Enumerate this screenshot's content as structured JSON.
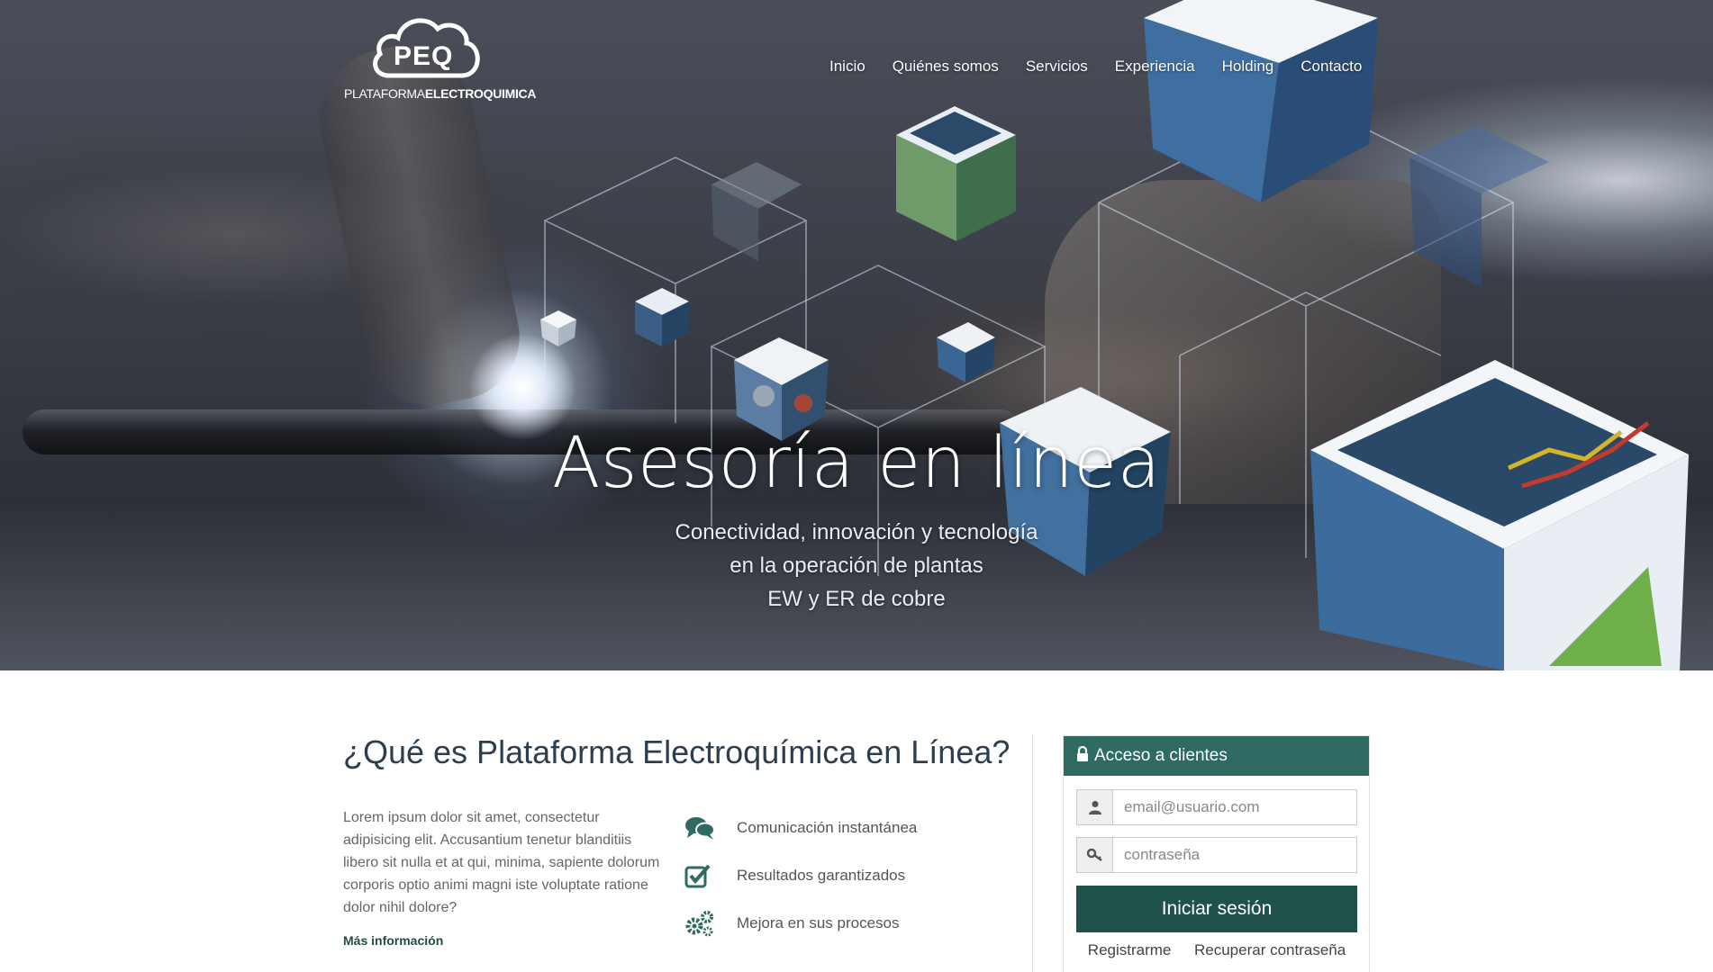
{
  "brand": {
    "logo_mark": "PEQ",
    "logo_sub_light": "PLATAFORMA",
    "logo_sub_bold": "ELECTROQUIMICA"
  },
  "nav": {
    "items": [
      {
        "label": "Inicio"
      },
      {
        "label": "Quiénes somos"
      },
      {
        "label": "Servicios"
      },
      {
        "label": "Experiencia"
      },
      {
        "label": "Holding"
      },
      {
        "label": "Contacto"
      }
    ]
  },
  "hero": {
    "title": "Asesoría en línea",
    "subtitle_lines": [
      "Conectividad, innovación y tecnología",
      "en la operación de plantas",
      "EW y ER de cobre"
    ]
  },
  "about": {
    "title": "¿Qué es Plataforma Electroquímica en Línea?",
    "text": "Lorem ipsum dolor sit amet, consectetur adipisicing elit. Accusantium tenetur blanditiis libero sit nulla et at qui, minima, sapiente dolorum corporis optio animi magni iste voluptate ratione dolor nihil dolore?",
    "more_link": "Más información"
  },
  "features": [
    {
      "icon": "comments-icon",
      "label": "Comunicación instantánea"
    },
    {
      "icon": "checkbox-icon",
      "label": "Resultados garantizados"
    },
    {
      "icon": "gears-icon",
      "label": "Mejora en sus procesos"
    }
  ],
  "login": {
    "heading": "Acceso a clientes",
    "email_placeholder": "email@usuario.com",
    "password_placeholder": "contraseña",
    "submit_label": "Iniciar sesión",
    "register_link": "Registrarme",
    "recover_link": "Recuperar contraseña"
  },
  "colors": {
    "accent": "#2f6b62",
    "button": "#1f524b",
    "heading": "#2d3f4f"
  }
}
